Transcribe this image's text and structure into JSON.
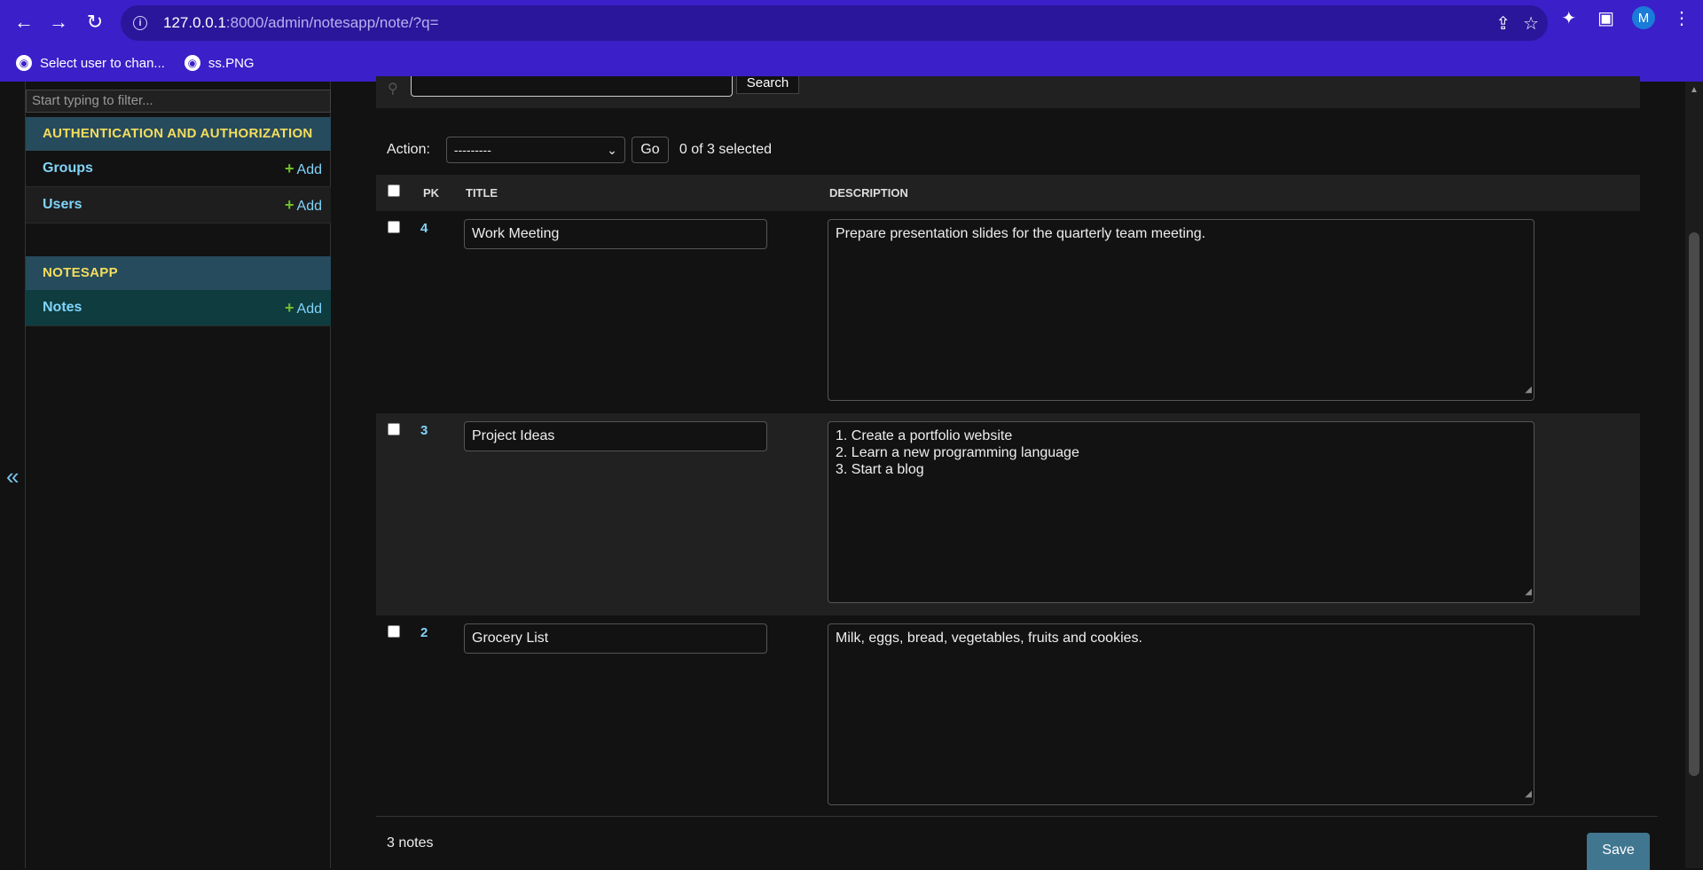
{
  "browser": {
    "url_host": "127.0.0.1",
    "url_rest": ":8000/admin/notesapp/note/?q=",
    "avatar_letter": "M",
    "bookmarks": [
      {
        "label": "Select user to chan..."
      },
      {
        "label": "ss.PNG"
      }
    ]
  },
  "sidebar": {
    "filter_placeholder": "Start typing to filter...",
    "collapse_label": "«",
    "apps": [
      {
        "name": "AUTHENTICATION AND AUTHORIZATION",
        "models": [
          {
            "name": "Groups",
            "add": "Add"
          },
          {
            "name": "Users",
            "add": "Add"
          }
        ]
      },
      {
        "name": "NOTESAPP",
        "models": [
          {
            "name": "Notes",
            "add": "Add"
          }
        ]
      }
    ]
  },
  "search": {
    "button": "Search"
  },
  "actions": {
    "label": "Action:",
    "selected_option": "---------",
    "go": "Go",
    "count": "0 of 3 selected"
  },
  "table": {
    "headers": {
      "pk": "PK",
      "title": "TITLE",
      "description": "DESCRIPTION"
    },
    "rows": [
      {
        "pk": "4",
        "title": "Work Meeting",
        "description": "Prepare presentation slides for the quarterly team meeting."
      },
      {
        "pk": "3",
        "title": "Project Ideas",
        "description": "1. Create a portfolio website\n2. Learn a new programming language\n3. Start a blog"
      },
      {
        "pk": "2",
        "title": "Grocery List",
        "description": "Milk, eggs, bread, vegetables, fruits and cookies."
      }
    ]
  },
  "footer": {
    "count": "3 notes",
    "save": "Save"
  },
  "colors": {
    "browser_chrome": "#3b1fc9",
    "app_header": "#264b5d",
    "link": "#81d4fa",
    "add_plus": "#70bf2b",
    "save_button": "#417690"
  }
}
